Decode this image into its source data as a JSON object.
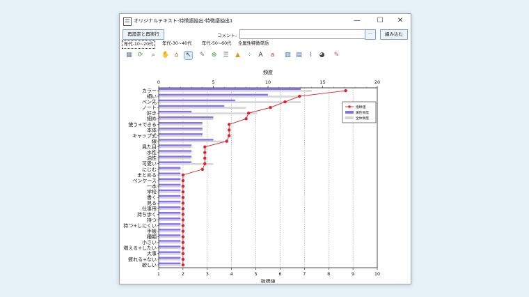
{
  "window": {
    "title": "オリジナルテキスト-特徴語抽出-特徴語抽出1",
    "minimize": "—",
    "maximize": "☐",
    "close": "✕"
  },
  "toolbar_row": {
    "rerun_label": "再設定と再実行",
    "column_label": "コメント:",
    "column_value": "",
    "more_label": "···",
    "embed_label": "組み込む"
  },
  "tabs": [
    "年代-10~20代",
    "年代-30~40代",
    "年代-50~60代",
    "全属性特徴単語"
  ],
  "active_tab": 0,
  "tool_icons": [
    "table-icon",
    "refresh-icon",
    "zoom-icon",
    "hand-icon",
    "home-icon",
    "pointer-icon",
    "chat-icon",
    "add-icon",
    "list-icon",
    "triangle-icon",
    "scatter-icon",
    "font-bigger-icon",
    "font-smaller-icon",
    "bar-chart-icon",
    "column-chart-icon",
    "line-chart-icon",
    "pie-icon",
    "paint-icon"
  ],
  "colors": {
    "indicator": "#e0202a",
    "attribute_freq": "#8870ee",
    "total_freq": "#d4d4d4"
  },
  "chart_data": {
    "type": "bar",
    "top_axis_label": "頻度",
    "bottom_axis_label": "指標値",
    "top_ticks": [
      0,
      5,
      10,
      15,
      20
    ],
    "top_range": [
      0,
      20
    ],
    "bottom_ticks": [
      1,
      2,
      3,
      4,
      5,
      6,
      7,
      8,
      9,
      10
    ],
    "bottom_range": [
      1,
      10
    ],
    "grid": true,
    "legend_position": "top-right",
    "legend": [
      "指標値",
      "属性頻度",
      "全体頻度"
    ],
    "categories": [
      "カラー",
      "細い",
      "ペン先",
      "ノート",
      "好き",
      "細め",
      "使う+できる",
      "本体",
      "キャップ式",
      "線",
      "見た目",
      "水性",
      "油性",
      "可愛い",
      "にじむ",
      "まとめる",
      "ペンケース",
      "一本",
      "学校",
      "書く",
      "見る",
      "仕事用",
      "持ち歩く",
      "持つ",
      "持つ+しにくい",
      "手帳",
      "種類",
      "小さい",
      "増える+したい",
      "大事",
      "疲れる+ない",
      "欲しい"
    ],
    "series": [
      {
        "name": "属性頻度",
        "values": [
          13,
          10,
          7,
          6,
          3,
          5,
          4,
          4,
          4,
          5,
          3,
          3,
          3,
          3,
          2,
          2,
          2,
          2,
          2,
          2,
          2,
          2,
          2,
          2,
          2,
          2,
          2,
          2,
          2,
          2,
          2,
          2
        ]
      },
      {
        "name": "全体頻度",
        "values": [
          14,
          13,
          13,
          8,
          9,
          5,
          4,
          4,
          4,
          6,
          3,
          3,
          3,
          5,
          2,
          2,
          2,
          2,
          2,
          2,
          2,
          2,
          2,
          2,
          2,
          2,
          2,
          2,
          2,
          2,
          2,
          2
        ]
      },
      {
        "name": "指標値",
        "values": [
          8.7,
          6.8,
          6.2,
          5.6,
          4.7,
          4.6,
          3.9,
          3.9,
          3.9,
          3.8,
          2.9,
          2.9,
          2.9,
          2.9,
          2.8,
          2.0,
          2.0,
          2.0,
          2.0,
          2.0,
          2.0,
          2.0,
          2.0,
          2.0,
          2.0,
          2.0,
          2.0,
          2.0,
          2.0,
          2.0,
          2.0,
          2.0
        ]
      }
    ]
  }
}
